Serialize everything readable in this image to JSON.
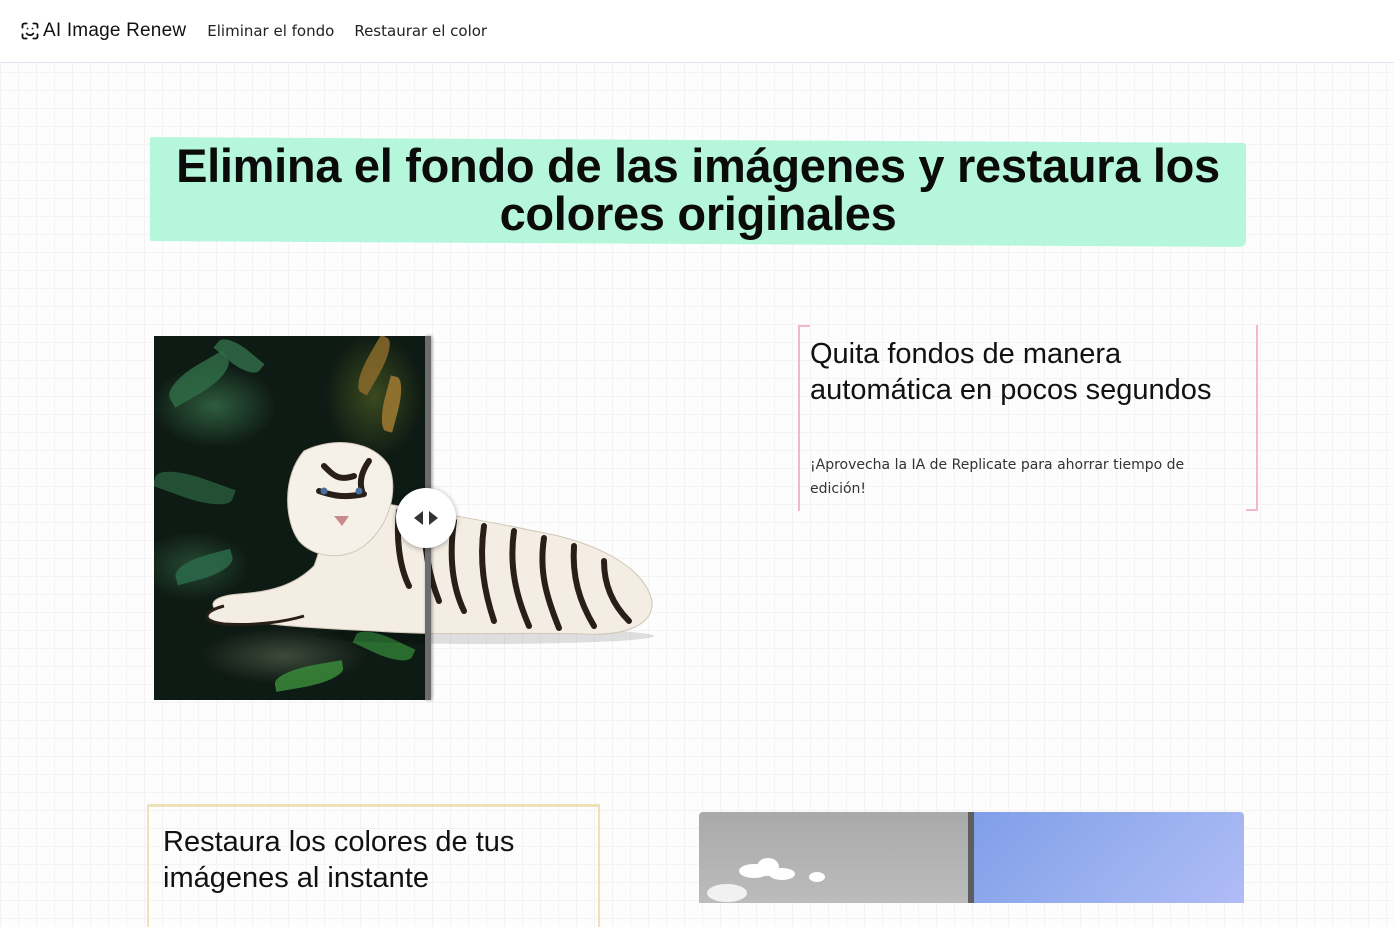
{
  "nav": {
    "brand": "AI Image Renew",
    "links": [
      "Eliminar el fondo",
      "Restaurar el color"
    ]
  },
  "hero": {
    "title_line1": "Elimina el fondo de las imágenes y restaura los",
    "title_line2": "colores originales",
    "highlight_color": "#b6f6dc"
  },
  "feature_remove_bg": {
    "title": "Quita fondos de manera automática en pocos segundos",
    "text": "¡Aprovecha la IA de Replicate para ahorrar tiempo de edición!",
    "accent_color": "#f2b8c6",
    "compare_handle_icon": "left-right-arrows-icon"
  },
  "feature_restore_color": {
    "title": "Restaura los colores de tus imágenes al instante",
    "accent_color": "#f0e2b8"
  }
}
